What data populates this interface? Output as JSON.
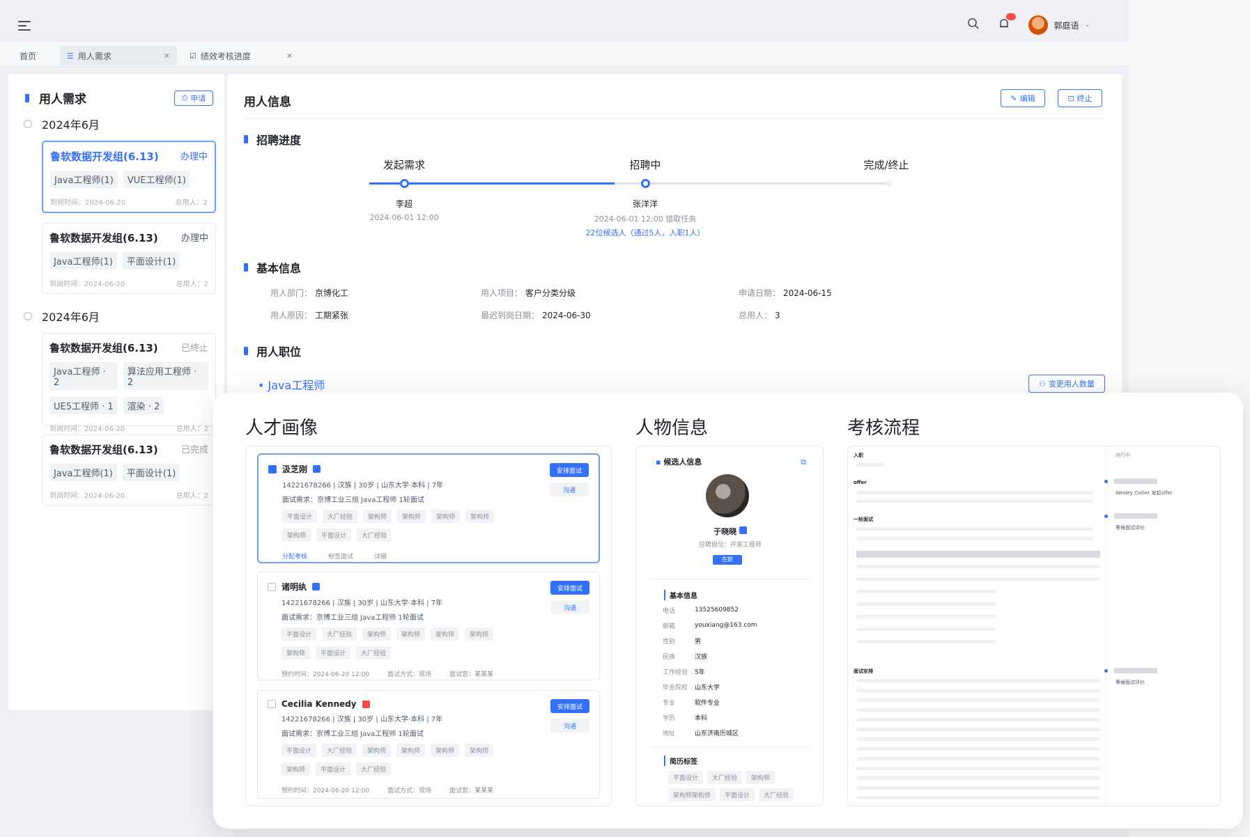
{
  "header": {
    "user_name": "郭庭语"
  },
  "tabs": [
    {
      "label": "首页"
    },
    {
      "label": "用人需求"
    },
    {
      "label": "绩效考核进度"
    }
  ],
  "sidebar": {
    "title": "用人需求",
    "apply_label": "申请",
    "groups": [
      {
        "month": "2024年6月",
        "cards": [
          {
            "title": "鲁软数据开发组(6.13)",
            "status": "办理中",
            "tags": [
              "Java工程师(1)",
              "VUE工程师(1)"
            ],
            "time": "到岗时间：2024-06-20",
            "total": "总用人：2"
          },
          {
            "title": "鲁软数据开发组(6.13)",
            "status": "办理中",
            "tags": [
              "Java工程师(1)",
              "平面设计(1)"
            ],
            "time": "到岗时间：2024-06-20",
            "total": "总用人：2"
          }
        ]
      },
      {
        "month": "2024年6月",
        "cards": [
          {
            "title": "鲁软数据开发组(6.13)",
            "status": "已终止",
            "tags": [
              "Java工程师 · 2",
              "算法应用工程师 · 2",
              "UE5工程师 · 1",
              "渲染 · 2"
            ],
            "time": "到岗时间：2024-06-20",
            "total": "总用人：2"
          },
          {
            "title": "鲁软数据开发组(6.13)",
            "status": "已完成",
            "tags": [
              "Java工程师(1)",
              "平面设计(1)"
            ],
            "time": "到岗时间：2024-06-20",
            "total": "总用人：2"
          }
        ]
      }
    ]
  },
  "main": {
    "title": "用人信息",
    "edit_label": "编辑",
    "stop_label": "终止",
    "progress": {
      "title": "招聘进度",
      "steps": [
        {
          "label": "发起需求",
          "person": "李超",
          "time": "2024-06-01 12:00"
        },
        {
          "label": "招聘中",
          "person": "张洋洋",
          "time": "2024-06-01 12:00 猎取任务",
          "note": "22位候选人（通过5人，入职1人）"
        },
        {
          "label": "完成/终止"
        }
      ]
    },
    "basic": {
      "title": "基本信息",
      "fields": [
        {
          "key": "用人部门：",
          "value": "京博化工"
        },
        {
          "key": "用人项目：",
          "value": "客户分类分级"
        },
        {
          "key": "申请日期：",
          "value": "2024-06-15"
        },
        {
          "key": "用人原因：",
          "value": "工期紧张"
        },
        {
          "key": "最迟到岗日期：",
          "value": "2024-06-30"
        },
        {
          "key": "总用人：",
          "value": "3"
        }
      ]
    },
    "positions": {
      "title": "用人职位",
      "current": "Java工程师",
      "change_label": "变更用人数量"
    }
  },
  "overlay": {
    "talent_title": "人才画像",
    "person_title": "人物信息",
    "flow_title": "考核流程",
    "candidates": [
      {
        "name": "汲芝刚",
        "line1": "14221678266 | 汉族 | 30岁 | 山东大学·本科 | 7年",
        "line2": "面试需求：京博工业三组 Java工程师 1轮面试",
        "tags": [
          "平面设计",
          "大厂经验",
          "架构师",
          "架构师",
          "架构师",
          "架构师",
          "架构师",
          "平面设计",
          "大厂经验"
        ],
        "actions": [
          "分配考核",
          "标签面试",
          "详细"
        ],
        "btn1": "安排面试",
        "btn2": "沟通"
      },
      {
        "name": "诸明纨",
        "line1": "14221678266 | 汉族 | 30岁 | 山东大学·本科 | 7年",
        "line2": "面试需求：京博工业三组 Java工程师 1轮面试",
        "tags": [
          "平面设计",
          "大厂经验",
          "架构师",
          "架构师",
          "架构师",
          "架构师",
          "架构师",
          "平面设计",
          "大厂经验"
        ],
        "footer": [
          "预约时间：2024-06-20 12:00",
          "面试方式：现场",
          "面试官：某某某"
        ],
        "btn1": "安排面试",
        "btn2": "沟通"
      },
      {
        "name": "Cecilia Kennedy",
        "line1": "14221678266 | 汉族 | 30岁 | 山东大学·本科 | 7年",
        "line2": "面试需求：京博工业三组 Java工程师 1轮面试",
        "tags": [
          "平面设计",
          "大厂经验",
          "架构师",
          "架构师",
          "架构师",
          "架构师",
          "架构师",
          "平面设计",
          "大厂经验"
        ],
        "footer": [
          "预约时间：2024-06-20 12:00",
          "面试方式：现场",
          "面试官：某某某"
        ],
        "btn1": "安排面试",
        "btn2": "沟通"
      }
    ],
    "person": {
      "header": "候选人信息",
      "name": "于晓晓",
      "subtitle": "应聘岗位：开发工程师",
      "btn": "在职",
      "basic_title": "基本信息",
      "rows": [
        {
          "k": "电话",
          "v": "13525609852"
        },
        {
          "k": "邮箱",
          "v": "youxiang@163.com"
        },
        {
          "k": "性别",
          "v": "男"
        },
        {
          "k": "民族",
          "v": "汉族"
        },
        {
          "k": "工作经验",
          "v": "5年"
        },
        {
          "k": "毕业院校",
          "v": "山东大学"
        },
        {
          "k": "专业",
          "v": "软件专业"
        },
        {
          "k": "学历",
          "v": "本科"
        },
        {
          "k": "地址",
          "v": "山东济南历城区"
        }
      ],
      "resume_title": "简历标签",
      "resume_tags": [
        "平面设计",
        "大厂经验",
        "架构师",
        "架构师架构师",
        "平面设计",
        "大厂经验"
      ]
    },
    "flow": {
      "sections": [
        "入职",
        "offer",
        "一轮面试",
        "面试安排"
      ],
      "side": [
        "进行中",
        "Wesley Collier 发起offer",
        "等候面试评价",
        "等候面试评价"
      ]
    }
  }
}
